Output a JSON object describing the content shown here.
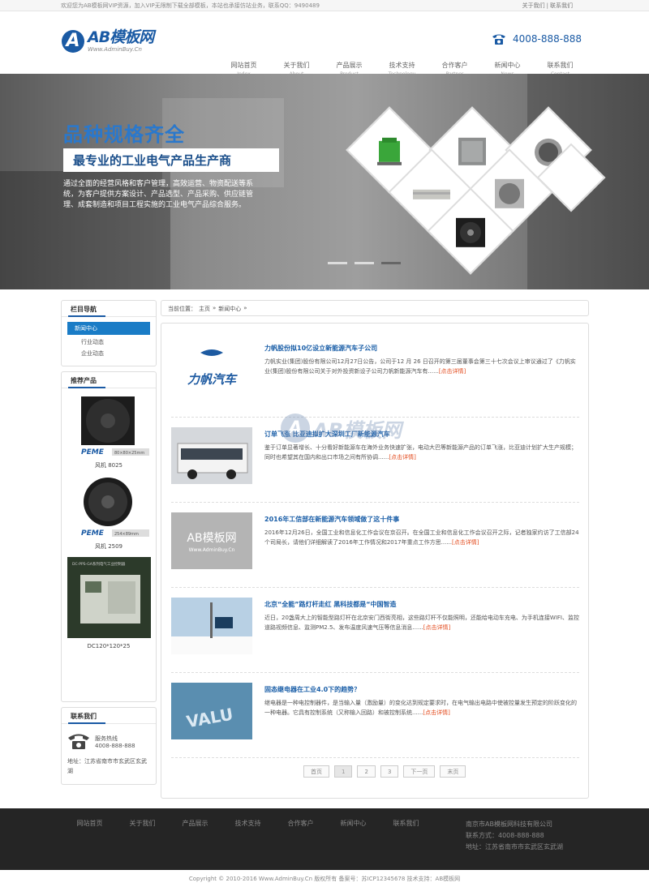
{
  "topbar": {
    "notice": "欢迎您为AB模板网VIP资源，加入VIP无限制下载全部模板，本站也承接仿站业务，联系QQ：9490489",
    "links": [
      "关于我们",
      "联系我们"
    ],
    "sep": "|"
  },
  "header": {
    "logo_letter": "A",
    "logo_main": "AB模板网",
    "logo_sub": "Www.AdminBuy.Cn",
    "phone": "4008-888-888"
  },
  "nav": [
    {
      "cn": "网站首页",
      "en": "Index"
    },
    {
      "cn": "关于我们",
      "en": "About"
    },
    {
      "cn": "产品展示",
      "en": "Product"
    },
    {
      "cn": "技术支持",
      "en": "Technology"
    },
    {
      "cn": "合作客户",
      "en": "Partner"
    },
    {
      "cn": "新闻中心",
      "en": "News"
    },
    {
      "cn": "联系我们",
      "en": "Contact"
    }
  ],
  "banner": {
    "title": "品种规格齐全",
    "subtitle": "最专业的工业电气产品生产商",
    "desc": "通过全面的经营风格和客户管理，高效运营、物资配送等系统，为客户提供方案设计、产品选型、产品采购、供应链管理、成套制造和项目工程实施的工业电气产品综合服务。"
  },
  "sidebar": {
    "nav_title": "栏目导航",
    "categories": [
      "新闻中心",
      "行业动态",
      "企业动态"
    ],
    "products_title": "推荐产品",
    "products": [
      {
        "name": "风机 8025",
        "brand": "PEME",
        "spec": "80×80×25mm"
      },
      {
        "name": "风机 2509",
        "brand": "PEME",
        "spec": "254×89mm"
      },
      {
        "name": "DC120*120*25",
        "label": "DC-PPS-GA系列电气工业控制器"
      }
    ],
    "contact_title": "联系我们",
    "hotline_label": "服务热线",
    "hotline": "4008-888-888",
    "address": "地址：江苏省南市市玄武区玄武湖"
  },
  "breadcrumb": {
    "label": "当前位置：",
    "home": "主页",
    "sep": "»",
    "current": "新闻中心",
    "tail": "»"
  },
  "news": [
    {
      "title": "力帆股份拟10亿设立新能源汽车子公司",
      "desc": "力帆实业(集团)股份有限公司12月27日公告，公司于12 月 26 日召开的第三届董事会第三十七次会议上审议通过了《力帆实业(集团)股份有限公司关于对外投资新设子公司力帆新能源汽车有......",
      "more": "[点击详情]",
      "thumb_text": "力帆汽车"
    },
    {
      "title": "订单飞涨 比亚迪拟扩大深圳工厂新能源汽车",
      "desc": "鉴于订单显著增长、十分看好新能源车在海外业务快速扩张，电动大巴等新能源产品的订单飞涨，比亚迪计划扩大生产规模；同时也希望其在国内和出口市场之间有所协调......",
      "more": "[点击详情]"
    },
    {
      "title": "2016年工信部在新能源汽车领域做了这十件事",
      "desc": "2016年12月26日，全国工业和信息化工作会议在京召开。在全国工业和信息化工作会议召开之际，记者独家约访了工信部24个司局长，请他们详细解读了2016年工作情况和2017年重点工作方思......",
      "more": "[点击详情]",
      "thumb_text": "AB模板网",
      "thumb_sub": "Www.AdminBuy.Cn"
    },
    {
      "title": "北京“全能”路灯杆走红 黑科技都是“中国智造",
      "desc": "近日，20盏周大上的智能型路灯杆在北京安门西街亮相，这些路灯杆不仅能照明，还能给电动车充电、为手机连接WIFI、监控道路视频信息、监测PM2.5、发布温度风速气压等信息消息......",
      "more": "[点击详情]"
    },
    {
      "title": "固态继电器在工业4.0下的趋势？",
      "desc": "继电器是一种电控制器件，是当输入量（激励量）的变化达到规定要求时，在电气输出电路中使被控量发生预定的阶跃变化的一种电器。它具有控制系统（又称输入回路）和被控制系统......",
      "more": "[点击详情]",
      "thumb_text": "VALU"
    }
  ],
  "pagination": [
    "首页",
    "1",
    "2",
    "3",
    "下一页",
    "末页"
  ],
  "footer": {
    "nav": [
      "网站首页",
      "关于我们",
      "产品展示",
      "技术支持",
      "合作客户",
      "新闻中心",
      "联系我们"
    ],
    "company": "南京市AB模板网科技有限公司",
    "contact": "联系方式：4008-888-888",
    "address": "地址：江苏省南市市玄武区玄武湖",
    "copyright": "Copyright © 2010-2016 Www.AdminBuy.Cn 版权所有   备案号：苏ICP12345678   技术支持：AB模板网"
  },
  "watermark": {
    "letter": "A",
    "text": "AB模板网"
  },
  "colors": {
    "brand": "#1a5aa4",
    "more": "#e34a1c",
    "footer": "#252525"
  }
}
